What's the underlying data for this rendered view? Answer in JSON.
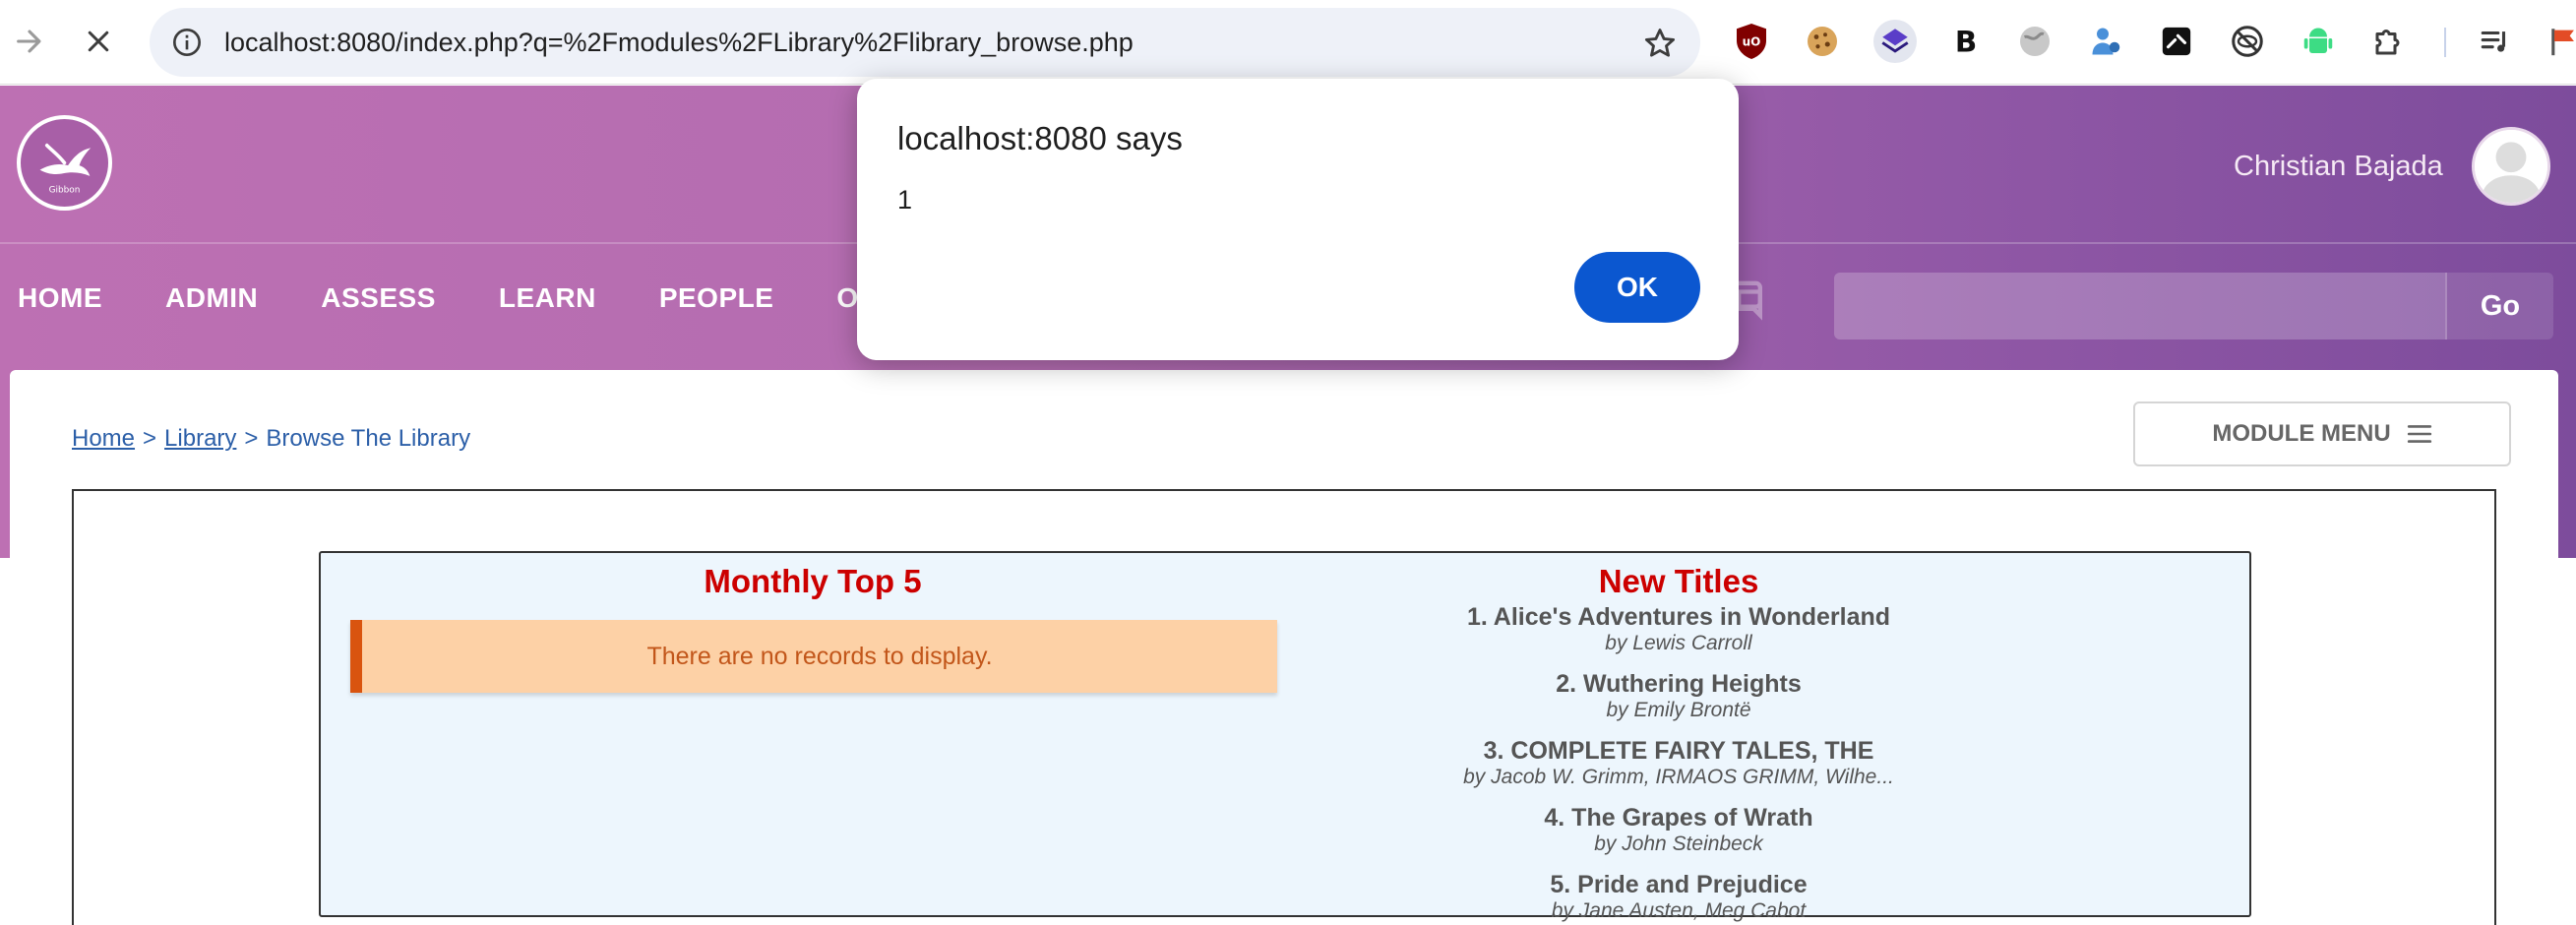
{
  "browser": {
    "url": "localhost:8080/index.php?q=%2Fmodules%2FLibrary%2Flibrary_browse.php",
    "extensions": [
      "ublock-icon",
      "cookie-icon",
      "layers-icon",
      "bold-b-icon",
      "globe-icon",
      "puzzle-person-icon",
      "terminal-icon",
      "blocked-eye-icon",
      "android-icon",
      "puzzle-icon",
      "media-icon",
      "flag-icon"
    ]
  },
  "header": {
    "logo_text": "Gibbon",
    "user_name": "Christian Bajada",
    "nav": {
      "home": "HOME",
      "admin": "ADMIN",
      "assess": "ASSESS",
      "learn": "LEARN",
      "people": "PEOPLE",
      "other": "OTHER"
    },
    "search": {
      "placeholder": "",
      "go_label": "Go"
    }
  },
  "breadcrumb": {
    "home": "Home",
    "library": "Library",
    "current": "Browse The Library",
    "separator": ">"
  },
  "module_menu_label": "MODULE MENU",
  "monthly_top5": {
    "title": "Monthly Top 5",
    "empty_message": "There are no records to display."
  },
  "new_titles": {
    "title": "New Titles",
    "items": [
      {
        "name": "1. Alice's Adventures in Wonderland",
        "author": "by Lewis Carroll"
      },
      {
        "name": "2. Wuthering Heights",
        "author": "by Emily Brontë"
      },
      {
        "name": "3. COMPLETE FAIRY TALES, THE",
        "author": "by Jacob W. Grimm, IRMAOS GRIMM, Wilhe..."
      },
      {
        "name": "4. The Grapes of Wrath",
        "author": "by John Steinbeck"
      },
      {
        "name": "5. Pride and Prejudice",
        "author": "by Jane Austen, Meg Cabot"
      }
    ]
  },
  "alert": {
    "title": "localhost:8080 says",
    "message": "1",
    "ok_label": "OK"
  },
  "colors": {
    "header_gradient_start": "#bd70b3",
    "header_gradient_end": "#7d4c9c",
    "panel_heading": "#cc0000",
    "panel_background": "#edf6fd",
    "warning_background": "#fdd1a6",
    "warning_border": "#d9540f",
    "link": "#2c5fa8",
    "dialog_button": "#0b57d0"
  }
}
